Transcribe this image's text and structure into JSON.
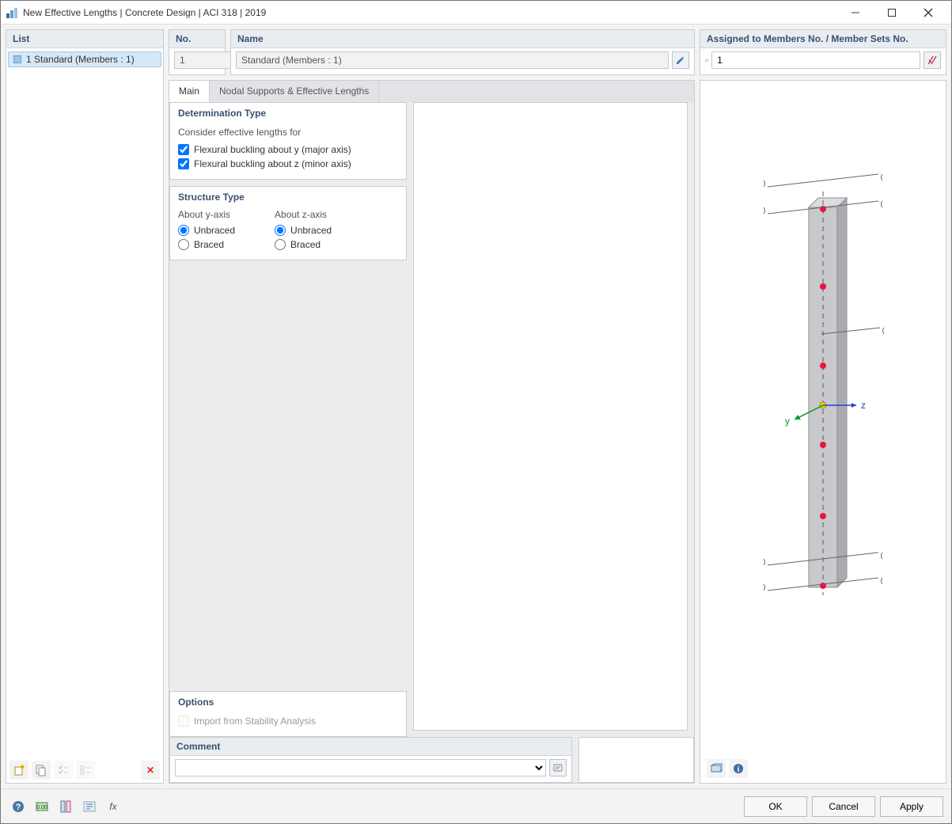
{
  "window": {
    "title": "New Effective Lengths | Concrete Design | ACI 318 | 2019"
  },
  "list": {
    "header": "List",
    "items": [
      "1 Standard (Members : 1)"
    ]
  },
  "no_field": {
    "header": "No.",
    "value": "1"
  },
  "name_field": {
    "header": "Name",
    "value": "Standard (Members : 1)"
  },
  "assigned": {
    "header": "Assigned to Members No. / Member Sets No.",
    "value": "1"
  },
  "tabs": {
    "main": "Main",
    "nodal": "Nodal Supports & Effective Lengths"
  },
  "determination": {
    "title": "Determination Type",
    "sub": "Consider effective lengths for",
    "opt_y": "Flexural buckling about y (major axis)",
    "opt_z": "Flexural buckling about z (minor axis)"
  },
  "structure": {
    "title": "Structure Type",
    "col_y": "About y-axis",
    "col_z": "About z-axis",
    "unbraced": "Unbraced",
    "braced": "Braced"
  },
  "options": {
    "title": "Options",
    "stability": "Import from Stability Analysis"
  },
  "comment": {
    "title": "Comment",
    "value": ""
  },
  "buttons": {
    "ok": "OK",
    "cancel": "Cancel",
    "apply": "Apply"
  },
  "axes": {
    "y": "y",
    "z": "z"
  }
}
